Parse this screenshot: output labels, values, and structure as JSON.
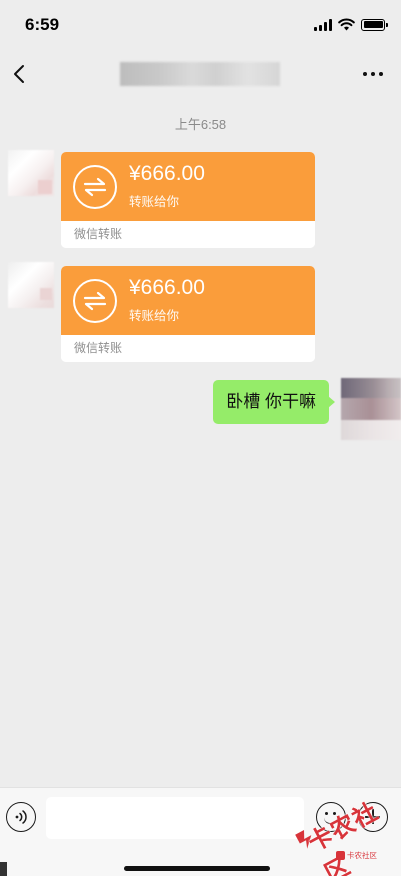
{
  "status_bar": {
    "time": "6:59"
  },
  "nav": {
    "back_icon": "chevron-left-icon",
    "more_icon": "more-dots-icon"
  },
  "chat": {
    "timestamp": "上午6:58",
    "transfers": [
      {
        "amount": "¥666.00",
        "note": "转账给你",
        "footer": "微信转账"
      },
      {
        "amount": "¥666.00",
        "note": "转账给你",
        "footer": "微信转账"
      }
    ],
    "outgoing_message": "卧槽 你干嘛"
  },
  "input_bar": {
    "voice_icon": "voice-icon",
    "emoji_icon": "emoji-icon",
    "plus_icon": "plus-icon",
    "input_value": ""
  },
  "watermark": {
    "text": "卡农社区",
    "badge": "卡农社区"
  },
  "colors": {
    "transfer_orange": "#fa9d3b",
    "outgoing_green": "#95ec69",
    "background": "#ededed",
    "watermark_red": "#d8343a"
  }
}
